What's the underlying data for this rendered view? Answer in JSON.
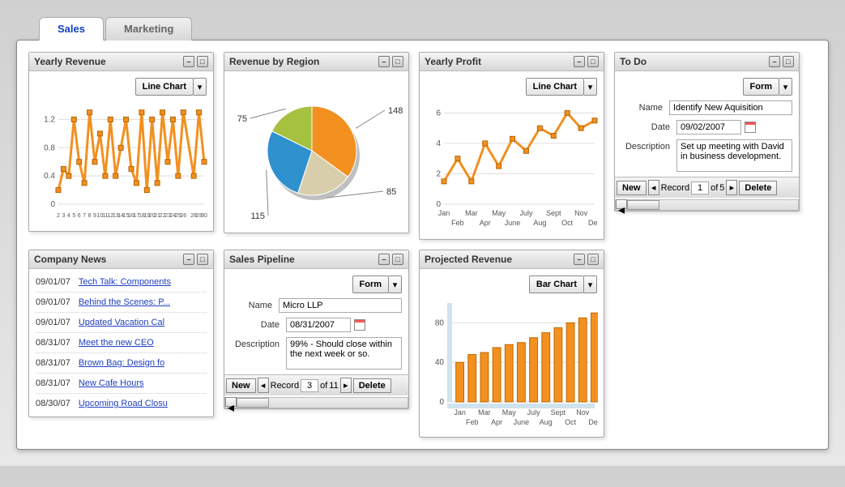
{
  "tabs": [
    {
      "label": "Sales",
      "active": true
    },
    {
      "label": "Marketing",
      "active": false
    }
  ],
  "portlets": {
    "yearly_revenue": {
      "title": "Yearly Revenue",
      "chart_type": "Line Chart"
    },
    "revenue_region": {
      "title": "Revenue by Region"
    },
    "yearly_profit": {
      "title": "Yearly Profit",
      "chart_type": "Line Chart"
    },
    "todo": {
      "title": "To Do",
      "view": "Form",
      "labels": {
        "name": "Name",
        "date": "Date",
        "desc": "Description"
      },
      "name": "Identify New Aquisition",
      "date": "09/02/2007",
      "description": "Set up meeting with David in business development.",
      "nav": {
        "new": "New",
        "record_label": "Record",
        "record": "1",
        "of": "of",
        "total": "5",
        "delete": "Delete"
      }
    },
    "company_news": {
      "title": "Company News",
      "items": [
        {
          "date": "09/01/07",
          "link": "Tech Talk: Components"
        },
        {
          "date": "09/01/07",
          "link": "Behind the Scenes: P..."
        },
        {
          "date": "09/01/07",
          "link": "Updated Vacation Cal"
        },
        {
          "date": "08/31/07",
          "link": "Meet the new CEO"
        },
        {
          "date": "08/31/07",
          "link": "Brown Bag: Design fo"
        },
        {
          "date": "08/31/07",
          "link": "New Cafe Hours"
        },
        {
          "date": "08/30/07",
          "link": "Upcoming Road Closu"
        }
      ]
    },
    "sales_pipeline": {
      "title": "Sales Pipeline",
      "view": "Form",
      "labels": {
        "name": "Name",
        "date": "Date",
        "desc": "Description"
      },
      "name": "Micro LLP",
      "date": "08/31/2007",
      "description": "99% - Should close within the next week or so.",
      "nav": {
        "new": "New",
        "record_label": "Record",
        "record": "3",
        "of": "of",
        "total": "11",
        "delete": "Delete"
      }
    },
    "projected_revenue": {
      "title": "Projected Revenue",
      "chart_type": "Bar Chart"
    }
  },
  "chart_data": [
    {
      "id": "yearly_revenue",
      "type": "line",
      "title": "Yearly Revenue",
      "x": [
        2,
        3,
        4,
        5,
        6,
        7,
        8,
        9,
        10,
        11,
        12,
        13,
        14,
        15,
        16,
        17,
        18,
        19,
        20,
        21,
        22,
        23,
        24,
        25,
        26,
        28,
        29,
        30
      ],
      "values": [
        0.2,
        0.5,
        0.4,
        1.2,
        0.6,
        0.3,
        1.3,
        0.6,
        1.0,
        0.4,
        1.2,
        0.4,
        0.8,
        1.2,
        0.5,
        0.3,
        1.3,
        0.2,
        1.2,
        0.3,
        1.3,
        0.6,
        1.2,
        0.4,
        1.3,
        0.4,
        1.3,
        0.6
      ],
      "ylim": [
        0,
        1.4
      ],
      "yticks": [
        0,
        0.4,
        0.8,
        1.2
      ]
    },
    {
      "id": "revenue_region",
      "type": "pie",
      "title": "Revenue by Region",
      "categories": [
        "148",
        "85",
        "115",
        "75"
      ],
      "values": [
        148,
        85,
        115,
        75
      ],
      "colors": [
        "#f29020",
        "#d8ceab",
        "#2f90ce",
        "#a6c040"
      ]
    },
    {
      "id": "yearly_profit",
      "type": "line",
      "title": "Yearly Profit",
      "categories": [
        "Jan",
        "Feb",
        "Mar",
        "Apr",
        "May",
        "June",
        "July",
        "Aug",
        "Sept",
        "Oct",
        "Nov",
        "Dec"
      ],
      "values": [
        1.5,
        3.0,
        1.5,
        4.0,
        2.5,
        4.3,
        3.5,
        5.0,
        4.5,
        6.0,
        5.0,
        5.5
      ],
      "ylim": [
        0,
        6.5
      ],
      "yticks": [
        0,
        2,
        4,
        6
      ]
    },
    {
      "id": "projected_revenue",
      "type": "bar",
      "title": "Projected Revenue",
      "categories": [
        "Jan",
        "Feb",
        "Mar",
        "Apr",
        "May",
        "June",
        "July",
        "Aug",
        "Sept",
        "Oct",
        "Nov",
        "Dec"
      ],
      "values": [
        40,
        48,
        50,
        55,
        58,
        60,
        65,
        70,
        75,
        80,
        85,
        90
      ],
      "ylim": [
        0,
        100
      ],
      "yticks": [
        0,
        40,
        80
      ]
    }
  ]
}
